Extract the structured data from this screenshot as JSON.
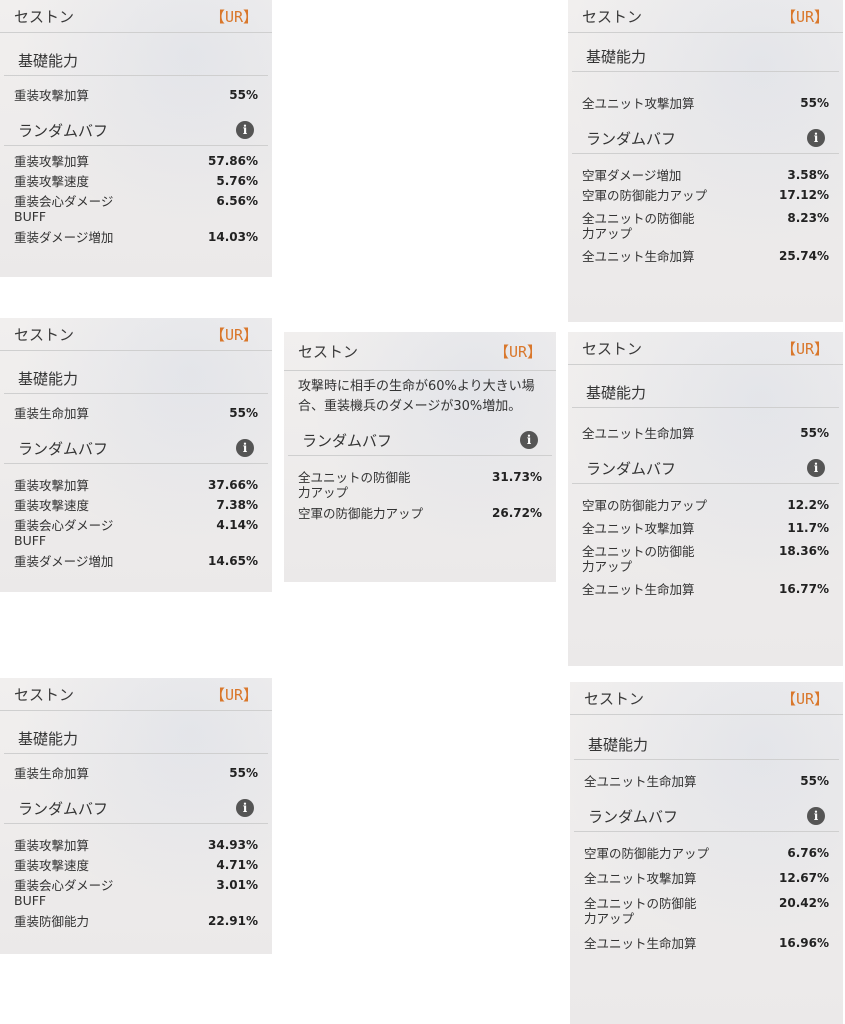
{
  "cards": [
    {
      "name": "セストン",
      "rarity": "【UR】",
      "base_title": "基礎能力",
      "base": [
        {
          "label": "重装攻撃加算",
          "value": "55%"
        }
      ],
      "random_title": "ランダムバフ",
      "random": [
        {
          "label": "重装攻撃加算",
          "value": "57.86%"
        },
        {
          "label": "重装攻撃速度",
          "value": "5.76%"
        },
        {
          "label": "重装会心ダメージBUFF",
          "value": "6.56%"
        },
        {
          "label": "重装ダメージ増加",
          "value": "14.03%"
        }
      ]
    },
    {
      "name": "セストン",
      "rarity": "【UR】",
      "base_title": "基礎能力",
      "base": [
        {
          "label": "全ユニット攻撃加算",
          "value": "55%"
        }
      ],
      "random_title": "ランダムバフ",
      "random": [
        {
          "label": "空軍ダメージ増加",
          "value": "3.58%"
        },
        {
          "label": "空軍の防御能力アップ",
          "value": "17.12%"
        },
        {
          "label": "全ユニットの防御能力アップ",
          "value": "8.23%"
        },
        {
          "label": "全ユニット生命加算",
          "value": "25.74%"
        }
      ]
    },
    {
      "name": "セストン",
      "rarity": "【UR】",
      "base_title": "基礎能力",
      "base": [
        {
          "label": "重装生命加算",
          "value": "55%"
        }
      ],
      "random_title": "ランダムバフ",
      "random": [
        {
          "label": "重装攻撃加算",
          "value": "37.66%"
        },
        {
          "label": "重装攻撃速度",
          "value": "7.38%"
        },
        {
          "label": "重装会心ダメージBUFF",
          "value": "4.14%"
        },
        {
          "label": "重装ダメージ増加",
          "value": "14.65%"
        }
      ]
    },
    {
      "name": "セストン",
      "rarity": "【UR】",
      "description": "攻撃時に相手の生命が60%より大きい場合、重装機兵のダメージが30%増加。",
      "random_title": "ランダムバフ",
      "random": [
        {
          "label": "全ユニットの防御能力アップ",
          "value": "31.73%"
        },
        {
          "label": "空軍の防御能力アップ",
          "value": "26.72%"
        }
      ]
    },
    {
      "name": "セストン",
      "rarity": "【UR】",
      "base_title": "基礎能力",
      "base": [
        {
          "label": "全ユニット生命加算",
          "value": "55%"
        }
      ],
      "random_title": "ランダムバフ",
      "random": [
        {
          "label": "空軍の防御能力アップ",
          "value": "12.2%"
        },
        {
          "label": "全ユニット攻撃加算",
          "value": "11.7%"
        },
        {
          "label": "全ユニットの防御能力アップ",
          "value": "18.36%"
        },
        {
          "label": "全ユニット生命加算",
          "value": "16.77%"
        }
      ]
    },
    {
      "name": "セストン",
      "rarity": "【UR】",
      "base_title": "基礎能力",
      "base": [
        {
          "label": "重装生命加算",
          "value": "55%"
        }
      ],
      "random_title": "ランダムバフ",
      "random": [
        {
          "label": "重装攻撃加算",
          "value": "34.93%"
        },
        {
          "label": "重装攻撃速度",
          "value": "4.71%"
        },
        {
          "label": "重装会心ダメージBUFF",
          "value": "3.01%"
        },
        {
          "label": "重装防御能力",
          "value": "22.91%"
        }
      ]
    },
    {
      "name": "セストン",
      "rarity": "【UR】",
      "base_title": "基礎能力",
      "base": [
        {
          "label": "全ユニット生命加算",
          "value": "55%"
        }
      ],
      "random_title": "ランダムバフ",
      "random": [
        {
          "label": "空軍の防御能力アップ",
          "value": "6.76%"
        },
        {
          "label": "全ユニット攻撃加算",
          "value": "12.67%"
        },
        {
          "label": "全ユニットの防御能力アップ",
          "value": "20.42%"
        },
        {
          "label": "全ユニット生命加算",
          "value": "16.96%"
        }
      ]
    }
  ],
  "info_icon": "info-icon"
}
